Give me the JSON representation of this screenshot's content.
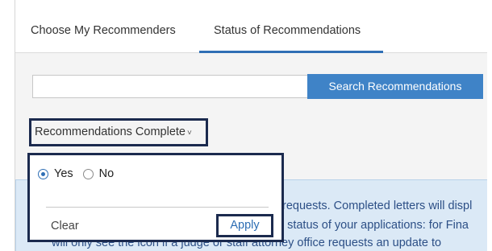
{
  "tabs": [
    {
      "label": "Choose My Recommenders"
    },
    {
      "label": "Status of Recommendations"
    }
  ],
  "search": {
    "value": "",
    "button_label": "Search Recommendations"
  },
  "filter": {
    "label": "Recommendations Complete",
    "caret": "˅"
  },
  "popover": {
    "options": [
      {
        "label": "Yes",
        "selected": true
      },
      {
        "label": "No",
        "selected": false
      }
    ],
    "clear_label": "Clear",
    "apply_label": "Apply"
  },
  "info": {
    "line1": "requests. Completed letters will displ",
    "line2": "e status of your applications: for Fina",
    "line3": "will only see the icon if a judge or staff attorney office requests an update to"
  },
  "colors": {
    "accent": "#2f6fb5",
    "button_bg": "#3f83c7",
    "highlight_border": "#1b2a4e",
    "info_bg": "#dbe9f6"
  }
}
